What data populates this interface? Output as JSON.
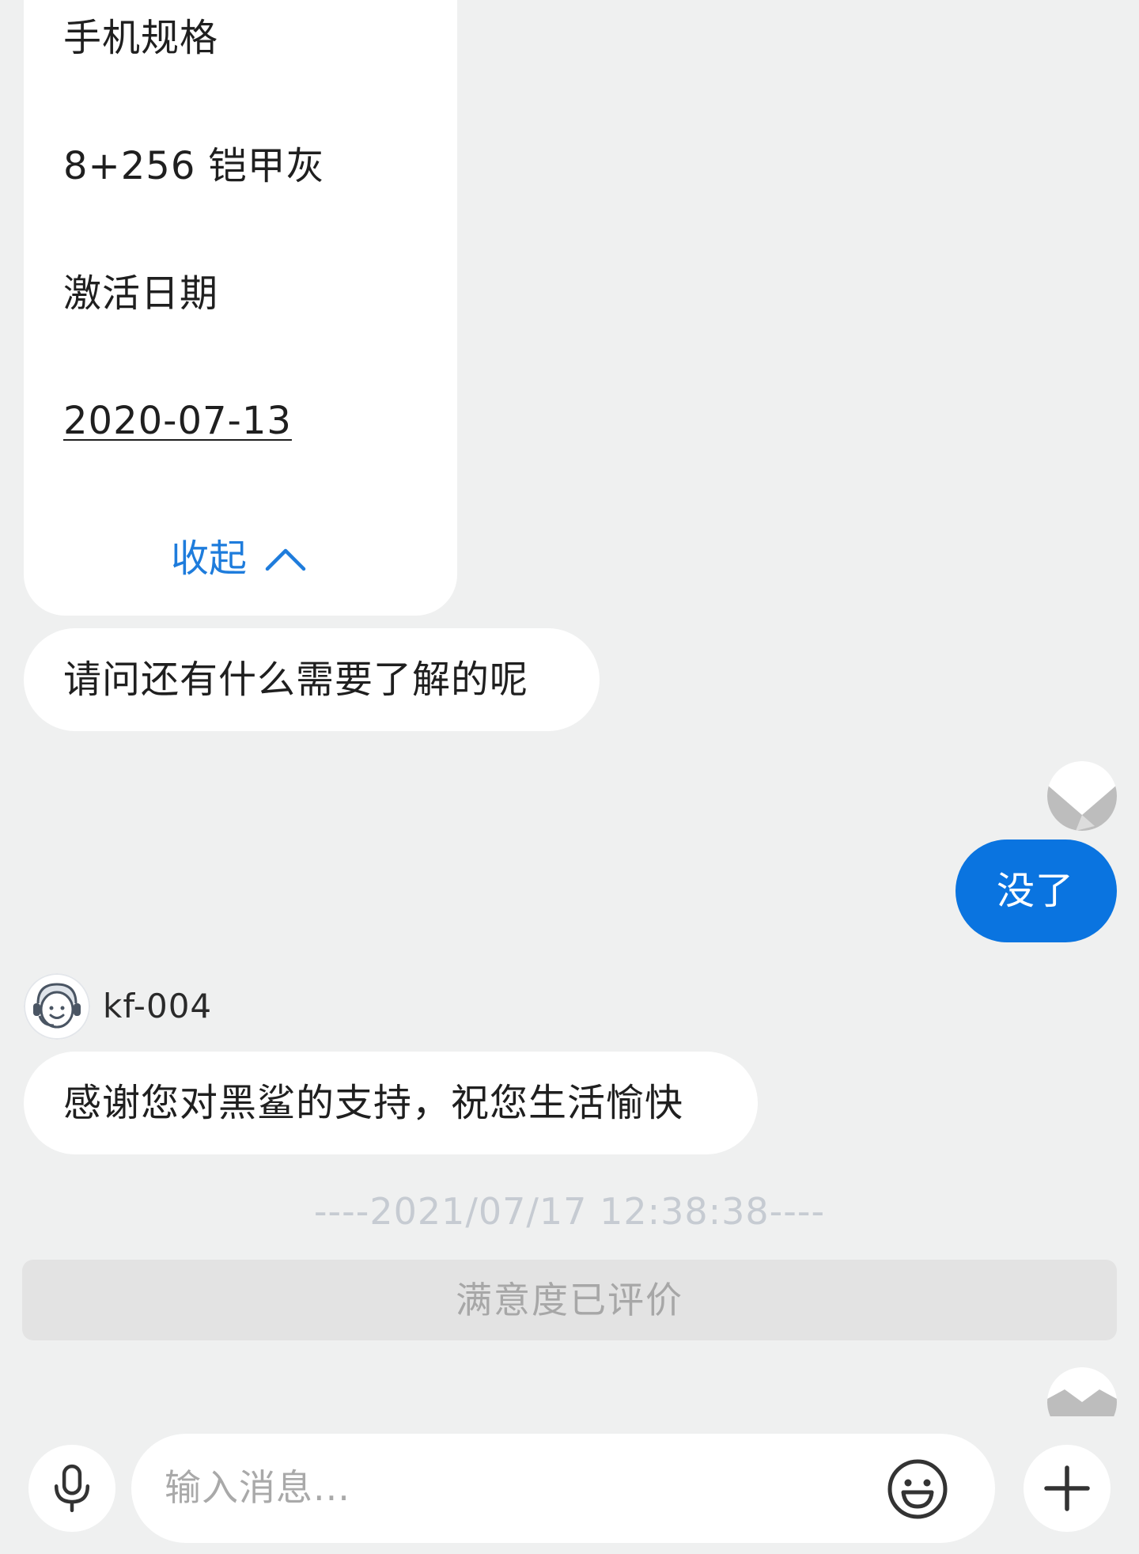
{
  "product_card": {
    "spec_label": "手机规格",
    "spec_value": "8+256 铠甲灰",
    "activation_label": "激活日期",
    "activation_value": "2020-07-13",
    "collapse_label": "收起"
  },
  "messages": {
    "agent_question": "请问还有什么需要了解的呢",
    "user_reply": "没了",
    "agent_name": "kf-004",
    "agent_closing": "感谢您对黑鲨的支持，祝您生活愉快"
  },
  "timestamp": "----2021/07/17 12:38:38----",
  "rating_status": "满意度已评价",
  "input": {
    "placeholder": "输入消息..."
  },
  "colors": {
    "accent": "#0a74e0",
    "link": "#1e7cdc",
    "background": "#eff0f0"
  },
  "icons": {
    "voice": "microphone-icon",
    "emoji": "emoji-icon",
    "more": "plus-icon",
    "collapse": "chevron-up-icon"
  }
}
